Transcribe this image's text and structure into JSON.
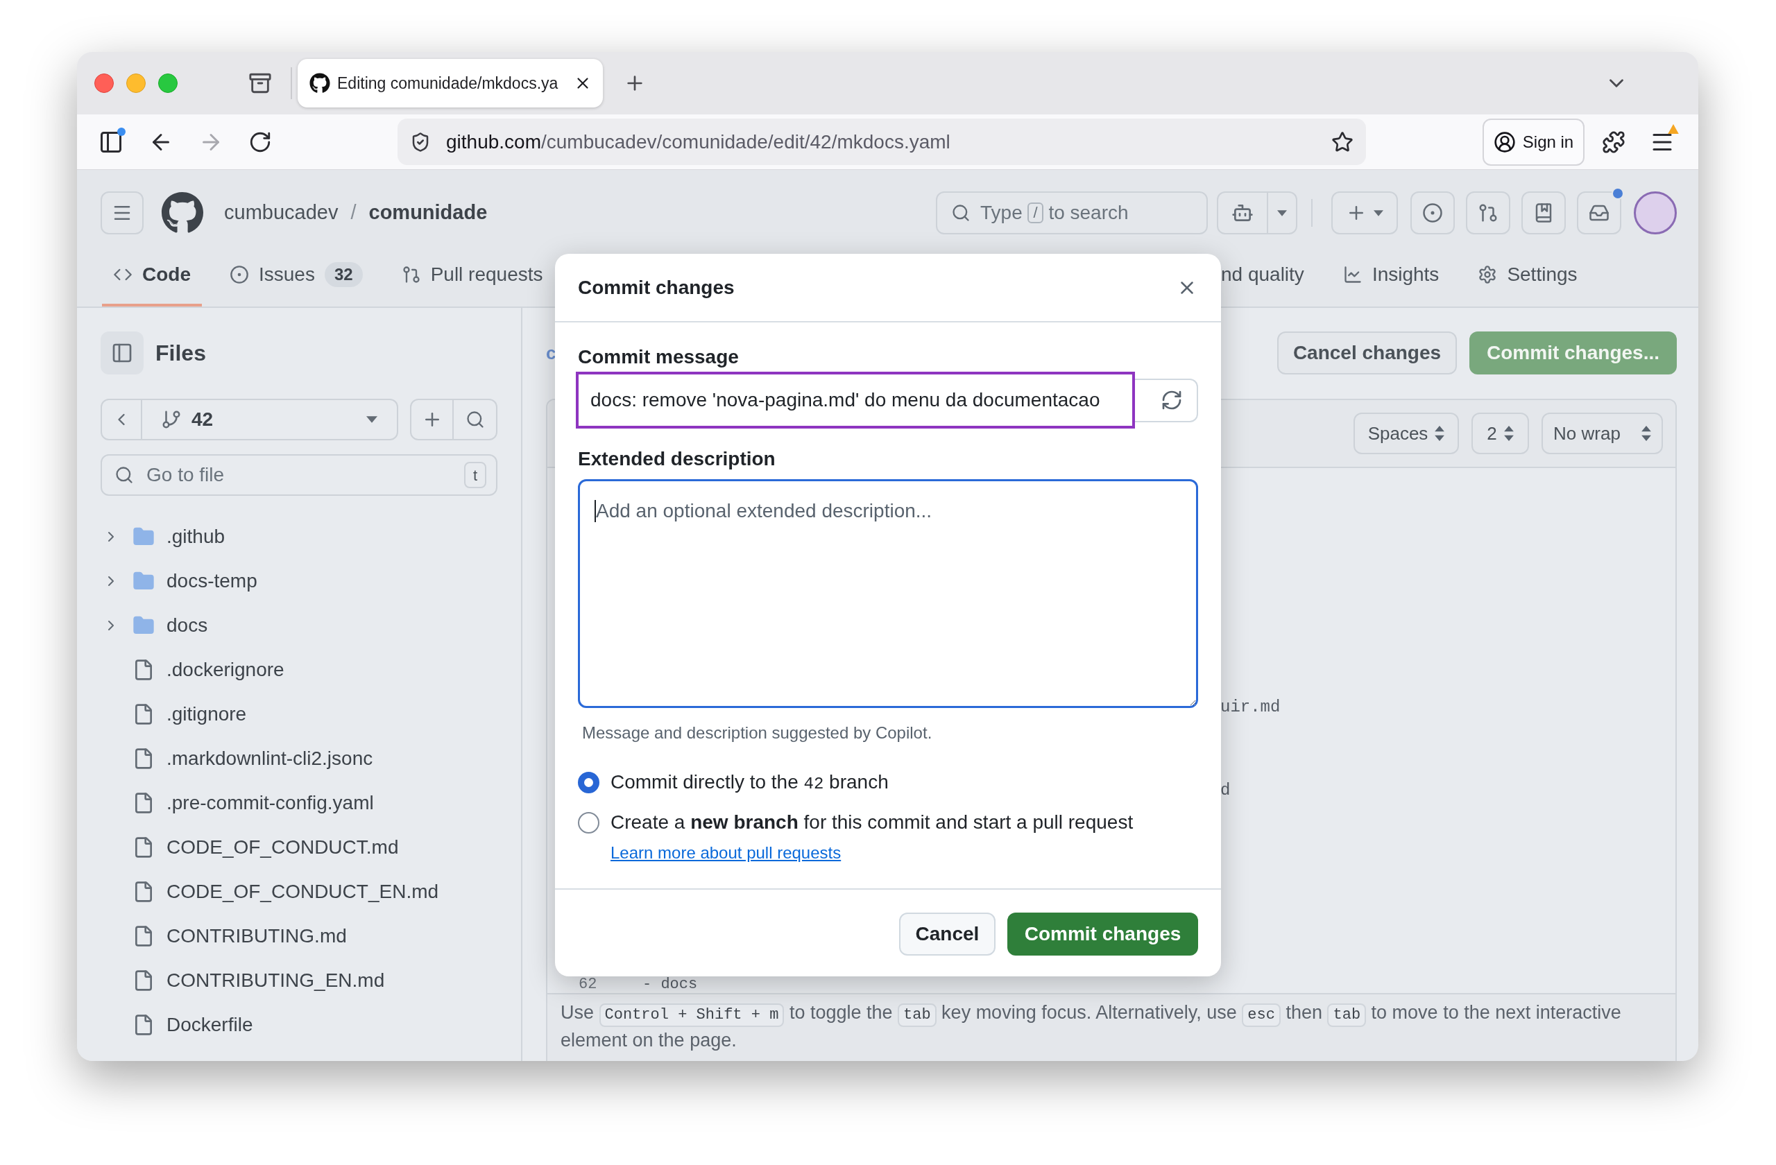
{
  "browser": {
    "tab": {
      "title": "Editing comunidade/mkdocs.ya",
      "selected": true
    },
    "forward_disabled": true,
    "url": {
      "host": "github.com",
      "path": "/cumbucadev/comunidade/edit/42/mkdocs.yaml"
    },
    "sign_in": "Sign in",
    "menu_alert": true
  },
  "header": {
    "owner": "cumbucadev",
    "separator": "/",
    "repo": "comunidade",
    "search": [
      {
        "kind": "text",
        "text": "Type "
      },
      {
        "kind": "key",
        "text": "/"
      },
      {
        "kind": "text",
        "text": " to search"
      }
    ],
    "inbox_unread": true
  },
  "repo_tabs": [
    {
      "label": "Code",
      "selected": true
    },
    {
      "label": "Issues",
      "count": "32",
      "selected": false
    },
    {
      "label": "Pull requests",
      "selected": false
    },
    {
      "label": "nd quality",
      "selected": false
    },
    {
      "label": "Insights",
      "selected": false
    },
    {
      "label": "Settings",
      "selected": false
    }
  ],
  "files": {
    "title": "Files",
    "branch": "42",
    "go_to_file": {
      "placeholder": "Go to file",
      "shortcut": "t"
    },
    "tree": [
      {
        "name": ".github",
        "kind": "folder",
        "expanded": false
      },
      {
        "name": "docs-temp",
        "kind": "folder",
        "expanded": false
      },
      {
        "name": "docs",
        "kind": "folder",
        "expanded": false
      },
      {
        "name": ".dockerignore",
        "kind": "file"
      },
      {
        "name": ".gitignore",
        "kind": "file"
      },
      {
        "name": ".markdownlint-cli2.jsonc",
        "kind": "file"
      },
      {
        "name": ".pre-commit-config.yaml",
        "kind": "file"
      },
      {
        "name": "CODE_OF_CONDUCT.md",
        "kind": "file"
      },
      {
        "name": "CODE_OF_CONDUCT_EN.md",
        "kind": "file"
      },
      {
        "name": "CONTRIBUTING.md",
        "kind": "file"
      },
      {
        "name": "CONTRIBUTING_EN.md",
        "kind": "file"
      },
      {
        "name": "Dockerfile",
        "kind": "file"
      }
    ]
  },
  "editor": {
    "breadcrumb": "c",
    "cancel": "Cancel changes",
    "commit": "Commit changes...",
    "indent_mode": "Spaces",
    "indent_size": "2",
    "wrap_mode": "No wrap",
    "code_fragments": [
      "uir.md",
      "d"
    ],
    "last_line": {
      "number": "62",
      "code": "- docs"
    },
    "focus_hint": [
      {
        "kind": "text",
        "text": "Use "
      },
      {
        "kind": "key",
        "text": "Control + Shift + m"
      },
      {
        "kind": "text",
        "text": " to toggle the "
      },
      {
        "kind": "key",
        "text": "tab"
      },
      {
        "kind": "text",
        "text": " key moving focus. Alternatively, use "
      },
      {
        "kind": "key",
        "text": "esc"
      },
      {
        "kind": "text",
        "text": " then "
      },
      {
        "kind": "key",
        "text": "tab"
      },
      {
        "kind": "text",
        "text": " to move to the next interactive element on the page."
      }
    ]
  },
  "commit_dialog": {
    "title": "Commit changes",
    "message_label": "Commit message",
    "message_value": "docs: remove 'nova-pagina.md' do menu da documentacao",
    "message_annotated": true,
    "description_label": "Extended description",
    "description_placeholder": "Add an optional extended description...",
    "description_focused": true,
    "suggestion_note": "Message and description suggested by Copilot.",
    "options": [
      {
        "segments": [
          {
            "kind": "text",
            "text": "Commit directly to the "
          },
          {
            "kind": "branch",
            "text": "42"
          },
          {
            "kind": "text",
            "text": " branch"
          }
        ],
        "selected": true
      },
      {
        "segments": [
          {
            "kind": "text",
            "text": "Create a "
          },
          {
            "kind": "strong",
            "text": "new branch"
          },
          {
            "kind": "text",
            "text": " for this commit and start a pull request"
          }
        ],
        "selected": false
      }
    ],
    "learn_more": "Learn more about pull requests",
    "cancel": "Cancel",
    "submit": "Commit changes"
  }
}
